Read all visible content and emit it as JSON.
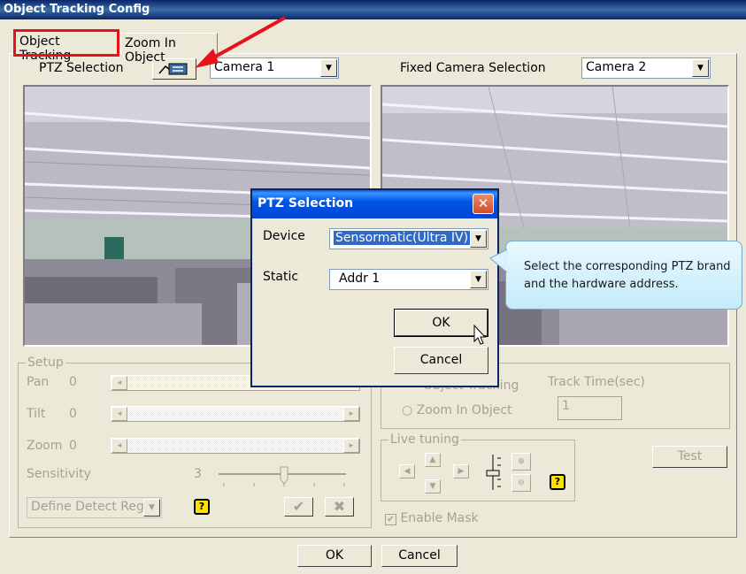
{
  "window": {
    "title": "Object Tracking Config"
  },
  "tabs": [
    {
      "label": "Object Tracking"
    },
    {
      "label": "Zoom In Object"
    }
  ],
  "ptz_selection": {
    "label": "PTZ Selection",
    "camera": "Camera 1"
  },
  "fixed_camera": {
    "label": "Fixed Camera Selection",
    "camera": "Camera 2"
  },
  "setup": {
    "legend": "Setup",
    "pan_label": "Pan",
    "pan_value": "0",
    "tilt_label": "Tilt",
    "tilt_value": "0",
    "zoom_label": "Zoom",
    "zoom_value": "0",
    "sensitivity_label": "Sensitivity",
    "sensitivity_value": "3",
    "define_region": "Define Detect Regi"
  },
  "mode": {
    "object_tracking": "Object Tracking",
    "zoom_in_object": "Zoom In Object",
    "track_time_label": "Track Time(sec)",
    "track_time_value": "1"
  },
  "live_tuning": {
    "legend": "Live tuning"
  },
  "test_button": "Test",
  "enable_mask": "Enable Mask",
  "footer": {
    "ok": "OK",
    "cancel": "Cancel"
  },
  "dialog": {
    "title": "PTZ Selection",
    "close": "✕",
    "device_label": "Device",
    "device_value": "Sensormatic(Ultra IV)",
    "static_label": "Static",
    "static_value": "Addr 1",
    "ok": "OK",
    "cancel": "Cancel"
  },
  "callout": {
    "text": "Select the corresponding PTZ brand and the hardware address."
  },
  "colors": {
    "highlight": "#e8121a",
    "xp_blue": "#0054e3",
    "callout_bg": "#c2ecfa"
  }
}
